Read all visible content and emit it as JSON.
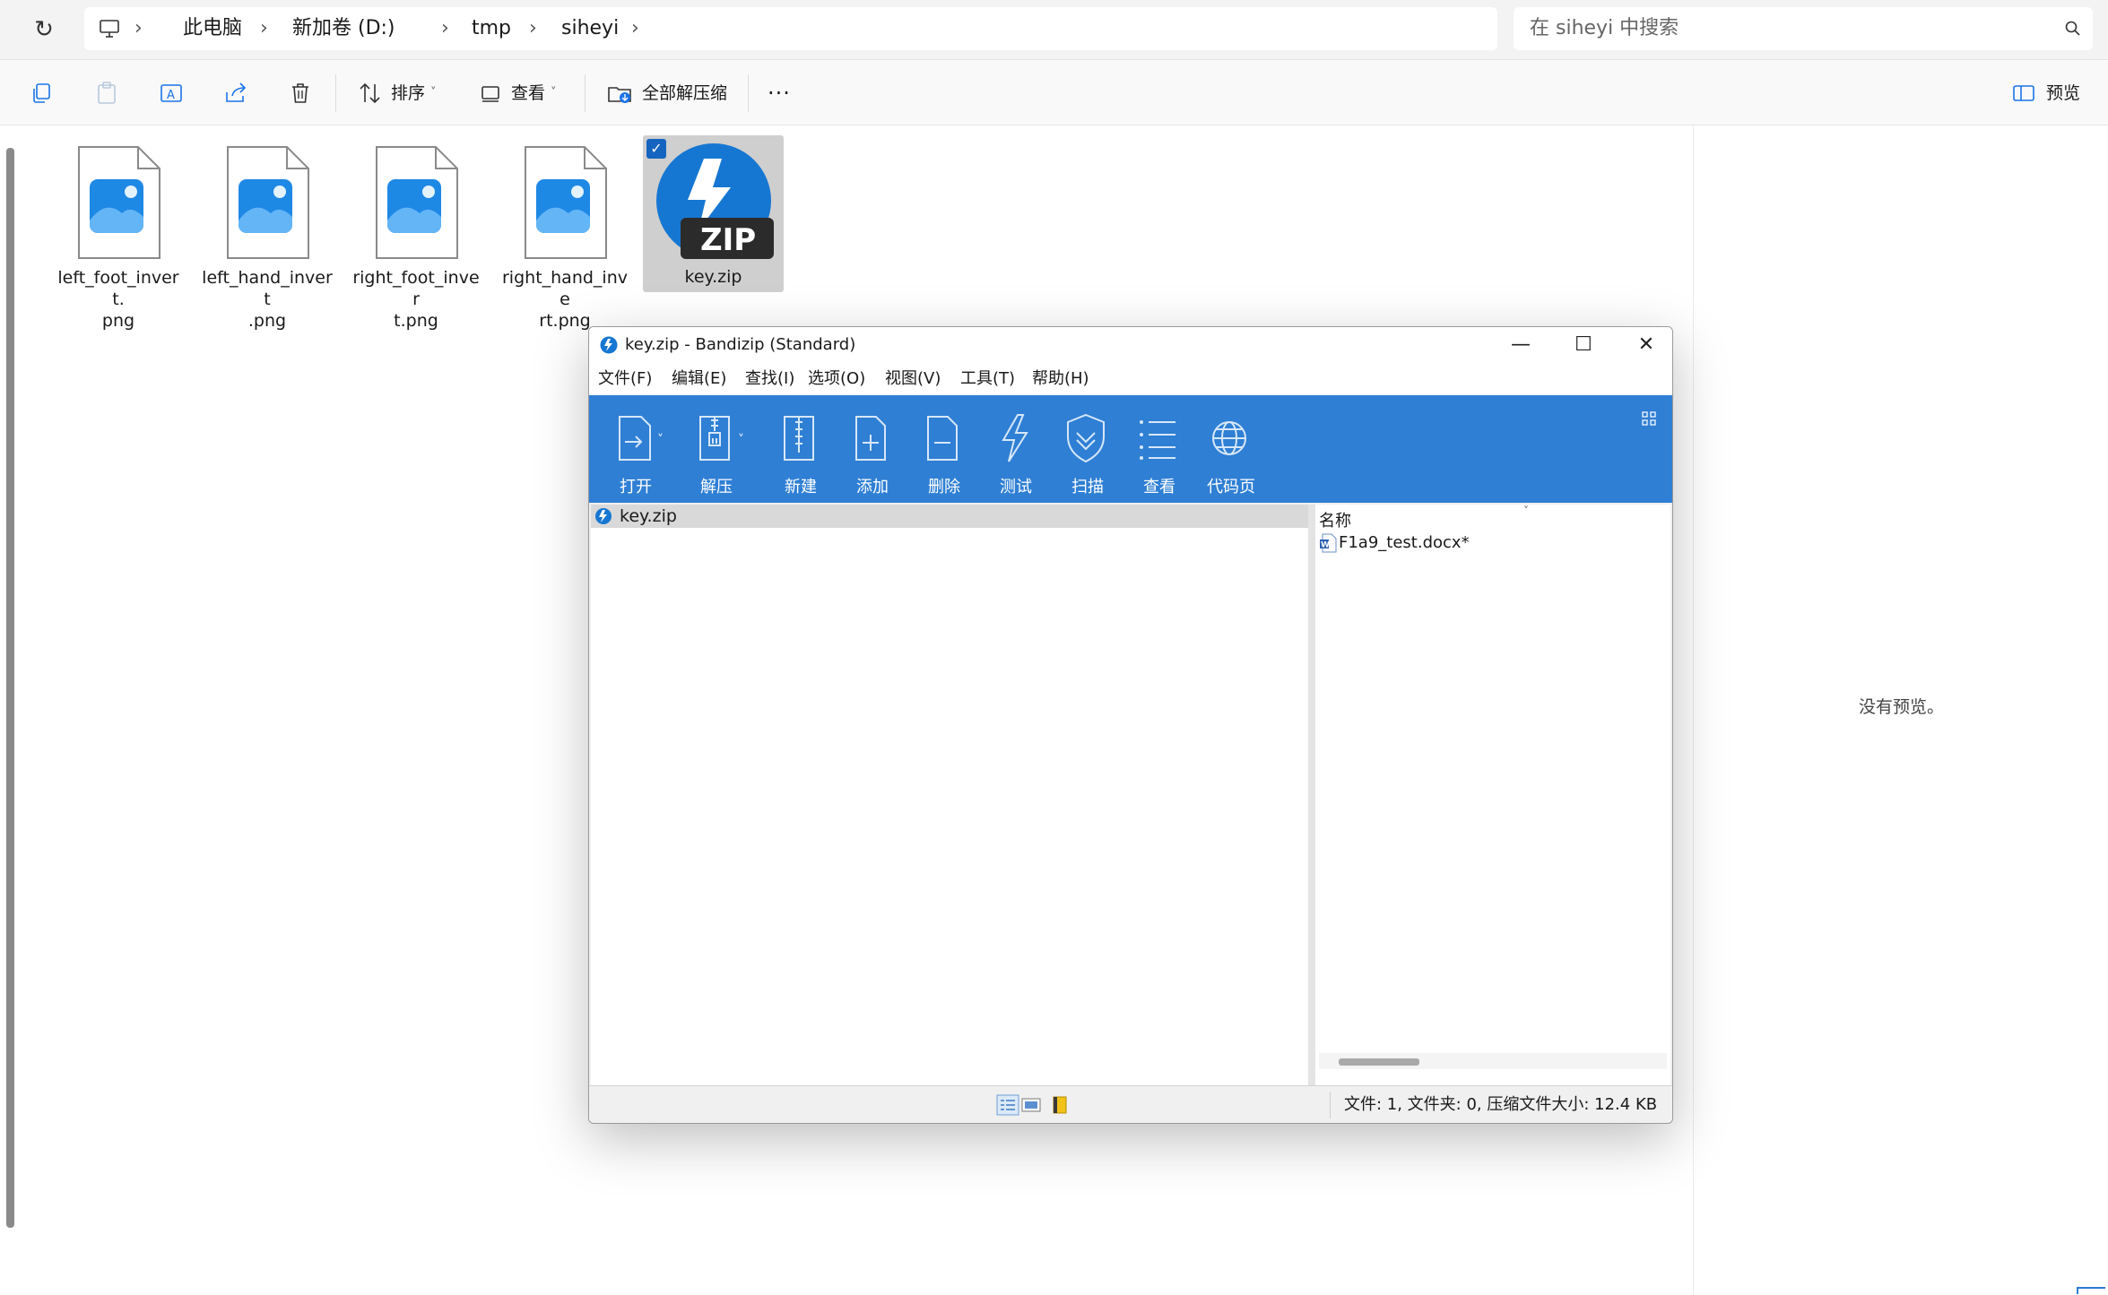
{
  "explorer": {
    "breadcrumb": [
      "此电脑",
      "新加卷 (D:)",
      "tmp",
      "siheyi"
    ],
    "search_placeholder": "在 siheyi 中搜索",
    "commands": {
      "sort": "排序",
      "view": "查看",
      "extract_all": "全部解压缩",
      "more": "···",
      "preview": "预览"
    },
    "files": [
      {
        "name": "left_foot_invert.png",
        "line1": "left_foot_invert.",
        "line2": "png",
        "type": "image"
      },
      {
        "name": "left_hand_invert.png",
        "line1": "left_hand_invert",
        "line2": ".png",
        "type": "image"
      },
      {
        "name": "right_foot_invert.png",
        "line1": "right_foot_inver",
        "line2": "t.png",
        "type": "image"
      },
      {
        "name": "right_hand_invert.png",
        "line1": "right_hand_inve",
        "line2": "rt.png",
        "type": "image"
      },
      {
        "name": "key.zip",
        "line1": "key.zip",
        "line2": "",
        "type": "zip",
        "selected": true
      }
    ],
    "preview_text": "没有预览。"
  },
  "bandizip": {
    "title": "key.zip - Bandizip (Standard)",
    "menu": [
      "文件(F)",
      "编辑(E)",
      "查找(I)",
      "选项(O)",
      "视图(V)",
      "工具(T)",
      "帮助(H)"
    ],
    "toolbar": [
      "打开",
      "解压",
      "新建",
      "添加",
      "删除",
      "测试",
      "扫描",
      "查看",
      "代码页"
    ],
    "tree_root": "key.zip",
    "column_name": "名称",
    "entries": [
      "F1a9_test.docx*"
    ],
    "status": "文件: 1, 文件夹: 0, 压缩文件大小: 12.4 KB",
    "accent_color": "#2f7fd4"
  }
}
